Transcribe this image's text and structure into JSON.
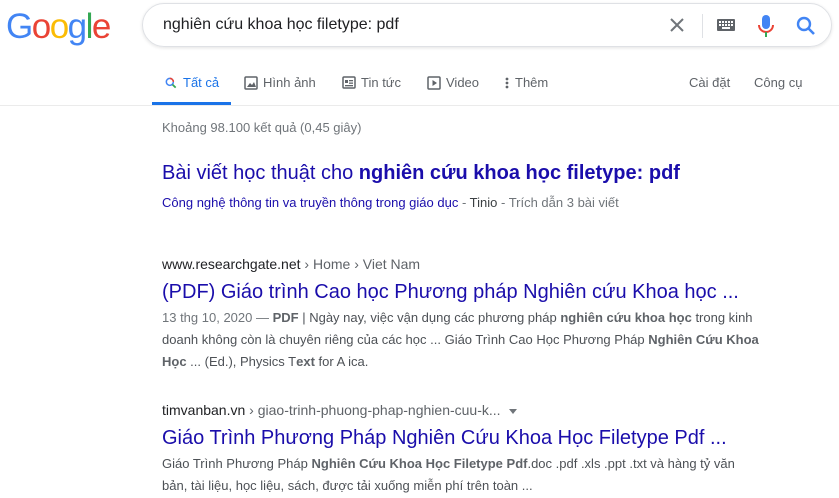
{
  "logo": {
    "letters": [
      "G",
      "o",
      "o",
      "g",
      "l",
      "e"
    ],
    "colors": [
      "#4285F4",
      "#EA4335",
      "#FBBC05",
      "#4285F4",
      "#34A853",
      "#EA4335"
    ]
  },
  "search": {
    "query": "nghiên cứu khoa học filetype: pdf"
  },
  "tabs": {
    "all": "Tất cả",
    "images": "Hình ảnh",
    "news": "Tin tức",
    "video": "Video",
    "more": "Thêm",
    "settings": "Cài đặt",
    "tools": "Công cụ"
  },
  "stats": "Khoảng 98.100 kết quả (0,45 giây)",
  "scholar": {
    "title_prefix": "Bài viết học thuật cho ",
    "title_bold": "nghiên cứu khoa học filetype: pdf",
    "article": "Công nghệ thông tin va truyền thông trong giáo dục",
    "sep": " - ",
    "author": "Tinio",
    "sep2": " - ",
    "cited": "Trích dẫn 3 bài viết"
  },
  "results": [
    {
      "domain": "www.researchgate.net",
      "path": " › Home › Viet Nam",
      "title": "(PDF) Giáo trình Cao học Phương pháp Nghiên cứu Khoa học ...",
      "date": "13 thg 10, 2020",
      "dash": " — ",
      "pdf": "PDF",
      "s1": " | Ngày nay, việc vận dụng các phương pháp ",
      "b1": "nghiên cứu khoa học",
      "s2": " trong kinh doanh không còn là chuyên riêng của các học ... Giáo Trình Cao Học Phương Pháp ",
      "b2": "Nghiên Cứu Khoa Học",
      "s3": " ... (Ed.), Physics T",
      "b3": "ext",
      "s4": " for A ica."
    },
    {
      "domain": "timvanban.vn",
      "path": " › giao-trinh-phuong-phap-nghien-cuu-k...",
      "title": "Giáo Trình Phương Pháp Nghiên Cứu Khoa Học Filetype Pdf ...",
      "s1": "Giáo Trình Phương Pháp ",
      "b1": "Nghiên Cứu Khoa Học Filetype Pdf",
      "s2": ".doc .pdf .xls .ppt .txt và hàng tỷ văn bản, tài liệu, học liệu, sách, được tải xuống miễn phí trên toàn ..."
    }
  ]
}
